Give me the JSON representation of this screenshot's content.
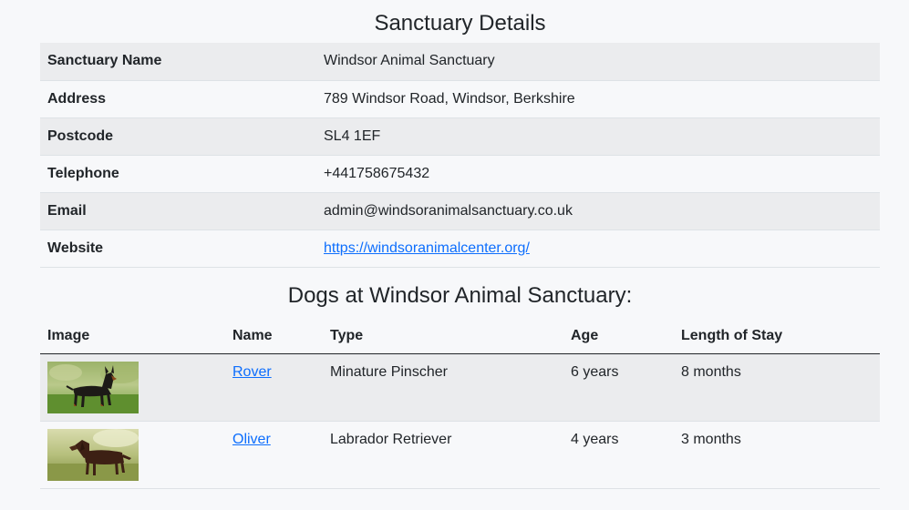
{
  "page_title": "Sanctuary Details",
  "details": [
    {
      "label": "Sanctuary Name",
      "value": "Windsor Animal Sanctuary"
    },
    {
      "label": "Address",
      "value": "789 Windsor Road, Windsor, Berkshire"
    },
    {
      "label": "Postcode",
      "value": "SL4 1EF"
    },
    {
      "label": "Telephone",
      "value": "+441758675432"
    },
    {
      "label": "Email",
      "value": "admin@windsoranimalsanctuary.co.uk"
    },
    {
      "label": "Website",
      "value": "https://windsoranimalcenter.org/"
    }
  ],
  "dogs_heading": "Dogs at Windsor Animal Sanctuary:",
  "dogs_columns": [
    "Image",
    "Name",
    "Type",
    "Age",
    "Length of Stay"
  ],
  "dogs": [
    {
      "image_icon": "dog-photo-miniature-pinscher",
      "name": "Rover",
      "type": "Minature Pinscher",
      "age": "6 years",
      "stay": "8 months"
    },
    {
      "image_icon": "dog-photo-labrador-retriever",
      "name": "Oliver",
      "type": "Labrador Retriever",
      "age": "4 years",
      "stay": "3 months"
    }
  ],
  "colors": {
    "link": "#0d6efd",
    "stripe": "#ebecee",
    "background": "#f7f8fa"
  }
}
